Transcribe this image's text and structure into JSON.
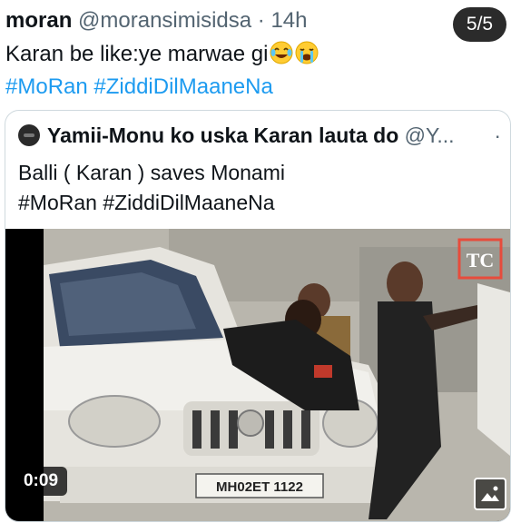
{
  "header": {
    "display_name": "moran",
    "handle": "@moransimisidsa",
    "separator": "·",
    "time": "14h",
    "media_counter": "5/5"
  },
  "tweet": {
    "text": "Karan be like:ye marwae gi",
    "emoji": "face-with-tears-of-joy, loudly-crying-face",
    "hashtags": [
      "#MoRan",
      "#ZiddiDilMaaneNa"
    ]
  },
  "quoted_tweet": {
    "display_name": "Yamii-Monu ko uska Karan lauta do",
    "handle": "@Y...",
    "more": "·",
    "text_line1": "Balli ( Karan ) saves Monami",
    "hashtags": [
      "#MoRan",
      "#ZiddiDilMaaneNa"
    ],
    "video": {
      "timestamp": "0:09",
      "plate_text": "MH02ET 1122",
      "watermark": "TC"
    }
  },
  "colors": {
    "hashtag": "#1d9bf0",
    "secondary_text": "#536471",
    "counter_bg": "#2b2b2b"
  }
}
